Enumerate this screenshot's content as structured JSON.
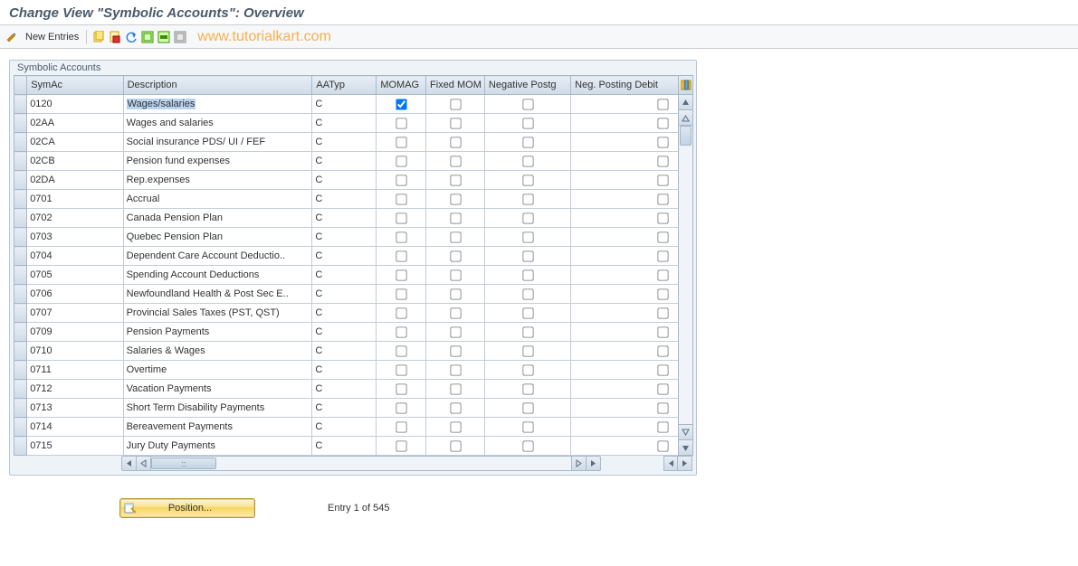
{
  "header": {
    "title": "Change View \"Symbolic Accounts\": Overview"
  },
  "toolbar": {
    "new_entries_label": "New Entries",
    "watermark": "www.tutorialkart.com"
  },
  "panel": {
    "title": "Symbolic Accounts"
  },
  "columns": {
    "symac": "SymAc",
    "description": "Description",
    "aatyp": "AATyp",
    "momag": "MOMAG",
    "fixed_mom": "Fixed MOM",
    "neg_postg": "Negative Postg",
    "neg_debit": "Neg. Posting Debit"
  },
  "rows": [
    {
      "symac": "0120",
      "desc": "Wages/salaries",
      "aatyp": "C",
      "momag": true,
      "fixed": false,
      "neg": false,
      "negd": false,
      "selected": true
    },
    {
      "symac": "02AA",
      "desc": "Wages and salaries",
      "aatyp": "C",
      "momag": false,
      "fixed": false,
      "neg": false,
      "negd": false
    },
    {
      "symac": "02CA",
      "desc": "Social insurance PDS/ UI / FEF",
      "aatyp": "C",
      "momag": false,
      "fixed": false,
      "neg": false,
      "negd": false
    },
    {
      "symac": "02CB",
      "desc": "Pension fund expenses",
      "aatyp": "C",
      "momag": false,
      "fixed": false,
      "neg": false,
      "negd": false
    },
    {
      "symac": "02DA",
      "desc": "Rep.expenses",
      "aatyp": "C",
      "momag": false,
      "fixed": false,
      "neg": false,
      "negd": false
    },
    {
      "symac": "0701",
      "desc": "Accrual",
      "aatyp": "C",
      "momag": false,
      "fixed": false,
      "neg": false,
      "negd": false
    },
    {
      "symac": "0702",
      "desc": "Canada Pension Plan",
      "aatyp": "C",
      "momag": false,
      "fixed": false,
      "neg": false,
      "negd": false
    },
    {
      "symac": "0703",
      "desc": "Quebec Pension Plan",
      "aatyp": "C",
      "momag": false,
      "fixed": false,
      "neg": false,
      "negd": false
    },
    {
      "symac": "0704",
      "desc": "Dependent Care Account Deductio..",
      "aatyp": "C",
      "momag": false,
      "fixed": false,
      "neg": false,
      "negd": false
    },
    {
      "symac": "0705",
      "desc": "Spending Account Deductions",
      "aatyp": "C",
      "momag": false,
      "fixed": false,
      "neg": false,
      "negd": false
    },
    {
      "symac": "0706",
      "desc": "Newfoundland Health & Post Sec E..",
      "aatyp": "C",
      "momag": false,
      "fixed": false,
      "neg": false,
      "negd": false
    },
    {
      "symac": "0707",
      "desc": "Provincial Sales Taxes (PST, QST)",
      "aatyp": "C",
      "momag": false,
      "fixed": false,
      "neg": false,
      "negd": false
    },
    {
      "symac": "0709",
      "desc": "Pension Payments",
      "aatyp": "C",
      "momag": false,
      "fixed": false,
      "neg": false,
      "negd": false
    },
    {
      "symac": "0710",
      "desc": "Salaries & Wages",
      "aatyp": "C",
      "momag": false,
      "fixed": false,
      "neg": false,
      "negd": false
    },
    {
      "symac": "0711",
      "desc": "Overtime",
      "aatyp": "C",
      "momag": false,
      "fixed": false,
      "neg": false,
      "negd": false
    },
    {
      "symac": "0712",
      "desc": "Vacation Payments",
      "aatyp": "C",
      "momag": false,
      "fixed": false,
      "neg": false,
      "negd": false
    },
    {
      "symac": "0713",
      "desc": "Short Term Disability Payments",
      "aatyp": "C",
      "momag": false,
      "fixed": false,
      "neg": false,
      "negd": false
    },
    {
      "symac": "0714",
      "desc": "Bereavement Payments",
      "aatyp": "C",
      "momag": false,
      "fixed": false,
      "neg": false,
      "negd": false
    },
    {
      "symac": "0715",
      "desc": "Jury Duty Payments",
      "aatyp": "C",
      "momag": false,
      "fixed": false,
      "neg": false,
      "negd": false
    }
  ],
  "footer": {
    "position_label": "Position...",
    "entry_text": "Entry 1 of 545"
  },
  "hscroll_thumb_label": "::"
}
